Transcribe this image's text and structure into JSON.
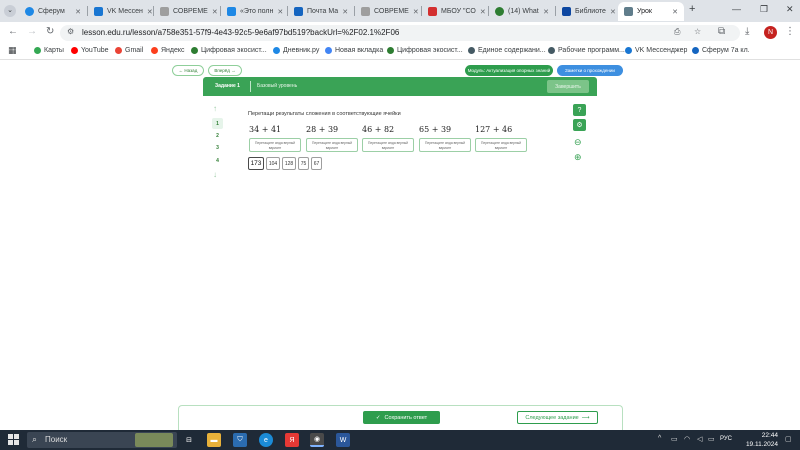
{
  "browser": {
    "tabs": [
      {
        "label": "Сферум",
        "color": "#1e88e5"
      },
      {
        "label": "VK Мессен",
        "color": "#1976d2"
      },
      {
        "label": "СОВРЕМЕ",
        "color": "#9e9e9e"
      },
      {
        "label": "«Это полн",
        "color": "#1e88e5"
      },
      {
        "label": "Почта Ма",
        "color": "#1565c0"
      },
      {
        "label": "СОВРЕМЕ",
        "color": "#9e9e9e"
      },
      {
        "label": "МБОУ \"СО",
        "color": "#d32f2f"
      },
      {
        "label": "(14) What",
        "color": "#2e7d32"
      },
      {
        "label": "Библиоте",
        "color": "#0d47a1"
      },
      {
        "label": "Урок",
        "color": "#607d8b"
      }
    ],
    "new_tab": "+",
    "url": "lesson.edu.ru/lesson/a758e351-57f9-4e43-92c5-9e6af97bd519?backUrl=%2F02.1%2F06",
    "avatar_letter": "N",
    "bookmarks": [
      {
        "label": "Карты",
        "color": "#34a853"
      },
      {
        "label": "YouTube",
        "color": "#ff0000"
      },
      {
        "label": "Gmail",
        "color": "#ea4335"
      },
      {
        "label": "Яндекс",
        "color": "#fc3f1d"
      },
      {
        "label": "Цифровая экосист...",
        "color": "#2e7d32"
      },
      {
        "label": "Дневник.ру",
        "color": "#1e88e5"
      },
      {
        "label": "Новая вкладка",
        "color": "#4285f4"
      },
      {
        "label": "Цифровая экосист...",
        "color": "#2e7d32"
      },
      {
        "label": "Единое содержани...",
        "color": "#455a64"
      },
      {
        "label": "Рабочие программ...",
        "color": "#455a64"
      },
      {
        "label": "VK Мессенджер",
        "color": "#1976d2"
      },
      {
        "label": "Сферум 7а кл.",
        "color": "#1565c0"
      }
    ]
  },
  "lesson": {
    "nav_back": "← Назад",
    "nav_next": "Вперёд →",
    "module_btn": "Модуль: Актуализация опорных знаний",
    "notes_btn": "Заметки о прохождении",
    "task_title": "Задание 1",
    "task_level": "Базовый уровень",
    "finish_btn": "Завершить",
    "question_numbers": [
      "1",
      "2",
      "3",
      "4"
    ],
    "instruction": "Перетащи результаты сложения в соответствующие ячейки",
    "expressions": [
      "34 + 41",
      "28 + 39",
      "46 + 82",
      "65 + 39",
      "127 + 46"
    ],
    "dropzone_hint": "Перетащите сюда верный вариант",
    "cards": [
      "173",
      "104",
      "128",
      "75",
      "67"
    ],
    "save_btn": "Сохранить ответ",
    "next_task_btn": "Следующее задание",
    "accent": "#3aa356"
  },
  "taskbar": {
    "search": "Поиск",
    "lang": "РУС",
    "time": "22:44",
    "date": "19.11.2024"
  }
}
